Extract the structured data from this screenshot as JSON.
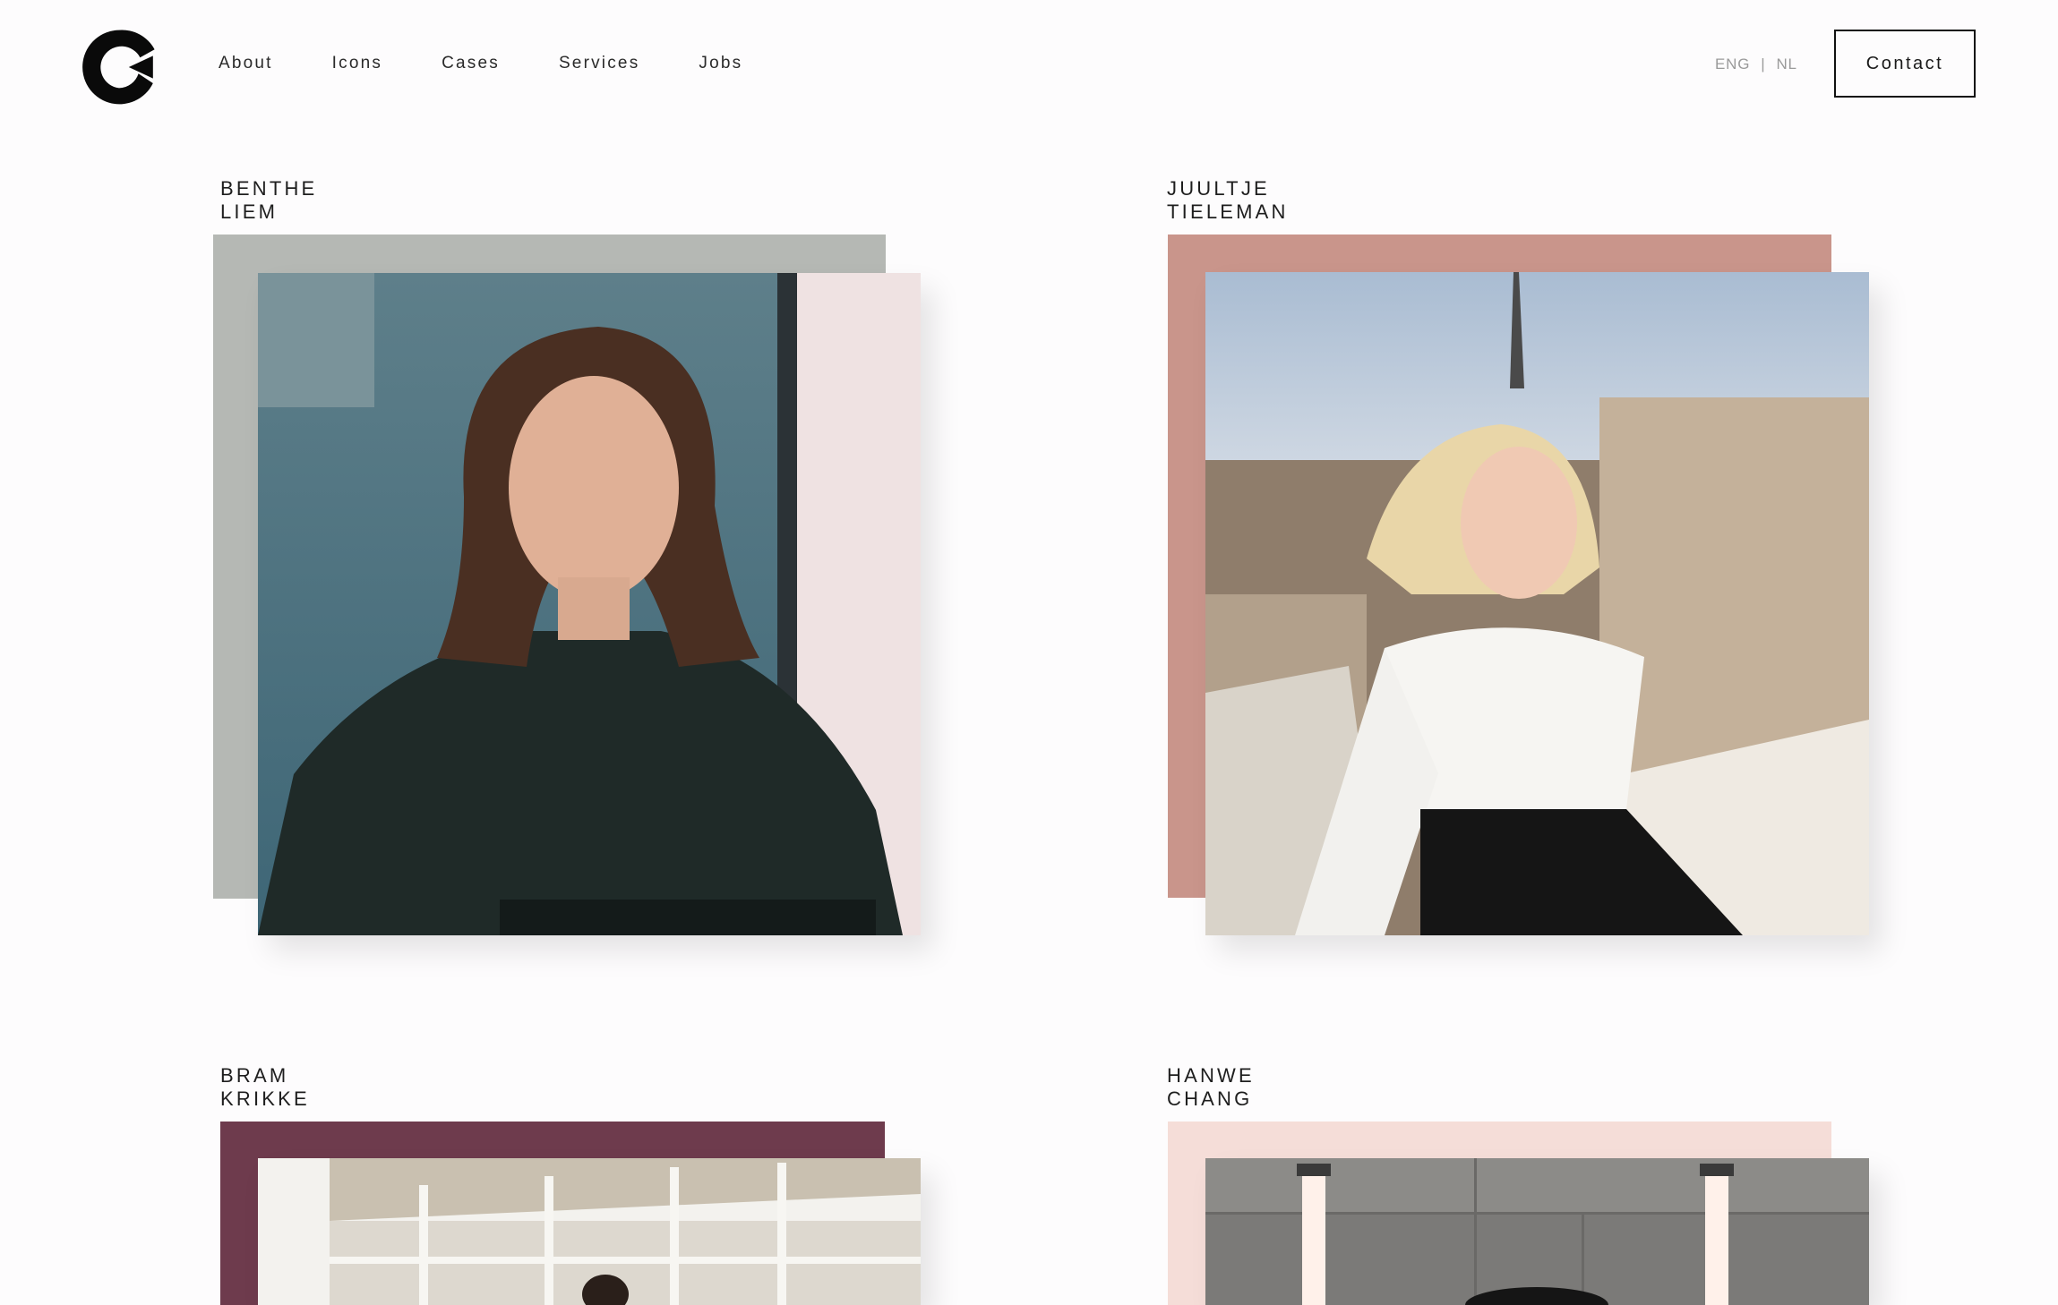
{
  "header": {
    "nav": [
      {
        "label": "About"
      },
      {
        "label": "Icons"
      },
      {
        "label": "Cases"
      },
      {
        "label": "Services"
      },
      {
        "label": "Jobs"
      }
    ],
    "lang": {
      "eng": "ENG",
      "separator": "|",
      "nl": "NL"
    },
    "contact_label": "Contact"
  },
  "cards": [
    {
      "name": "BENTHE LIEM",
      "accent": "#b5b8b4"
    },
    {
      "name": "JUULTJE TIELEMAN",
      "accent": "#c9958b"
    },
    {
      "name": "BRAM KRIKKE",
      "accent": "#6e3b4d"
    },
    {
      "name": "HANWE CHANG",
      "accent": "#f5ddd8"
    }
  ]
}
